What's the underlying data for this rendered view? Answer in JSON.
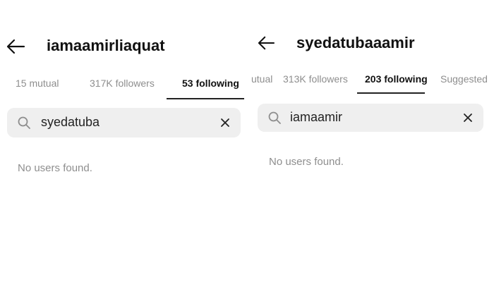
{
  "left_panel": {
    "title": "iamaamirliaquat",
    "tabs": [
      {
        "label": "15 mutual",
        "active": false
      },
      {
        "label": "317K followers",
        "active": false
      },
      {
        "label": "53 following",
        "active": true
      }
    ],
    "search": {
      "value": "syedatuba"
    },
    "empty_message": "No users found."
  },
  "right_panel": {
    "title": "syedatubaaamir",
    "tabs": [
      {
        "label": "utual",
        "active": false
      },
      {
        "label": "313K followers",
        "active": false
      },
      {
        "label": "203 following",
        "active": true
      },
      {
        "label": "Suggested",
        "active": false
      }
    ],
    "search": {
      "value": "iamaamir"
    },
    "empty_message": "No users found."
  },
  "icons": {
    "back": "arrow-left-icon",
    "search": "magnifier-icon",
    "clear": "close-x-icon"
  }
}
